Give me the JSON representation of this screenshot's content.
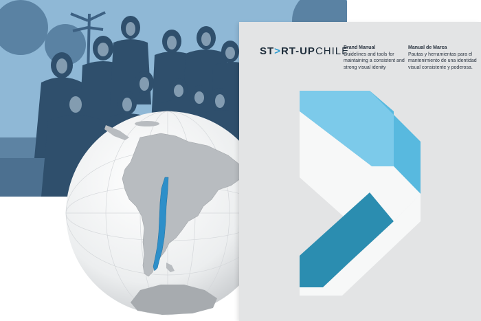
{
  "logo": {
    "part1": "ST",
    "accent": ">",
    "part2": "RT-UP",
    "part3": "CHILE"
  },
  "manual_en": {
    "heading": "Brand Manual",
    "body": "Guidelines and tools for maintaining a consistent and strong visual idenity"
  },
  "manual_es": {
    "heading": "Manual de Marca",
    "body": "Pautas y herramientas para el mantenimiento de una identidad visual consistente y poderosa."
  },
  "colors": {
    "photo_tint": "#7fa9c9",
    "chile_highlight": "#2e8fc9",
    "chevron_light": "#7ccaea",
    "chevron_dark": "#2b8db0",
    "cover_bg": "#e3e4e5"
  }
}
